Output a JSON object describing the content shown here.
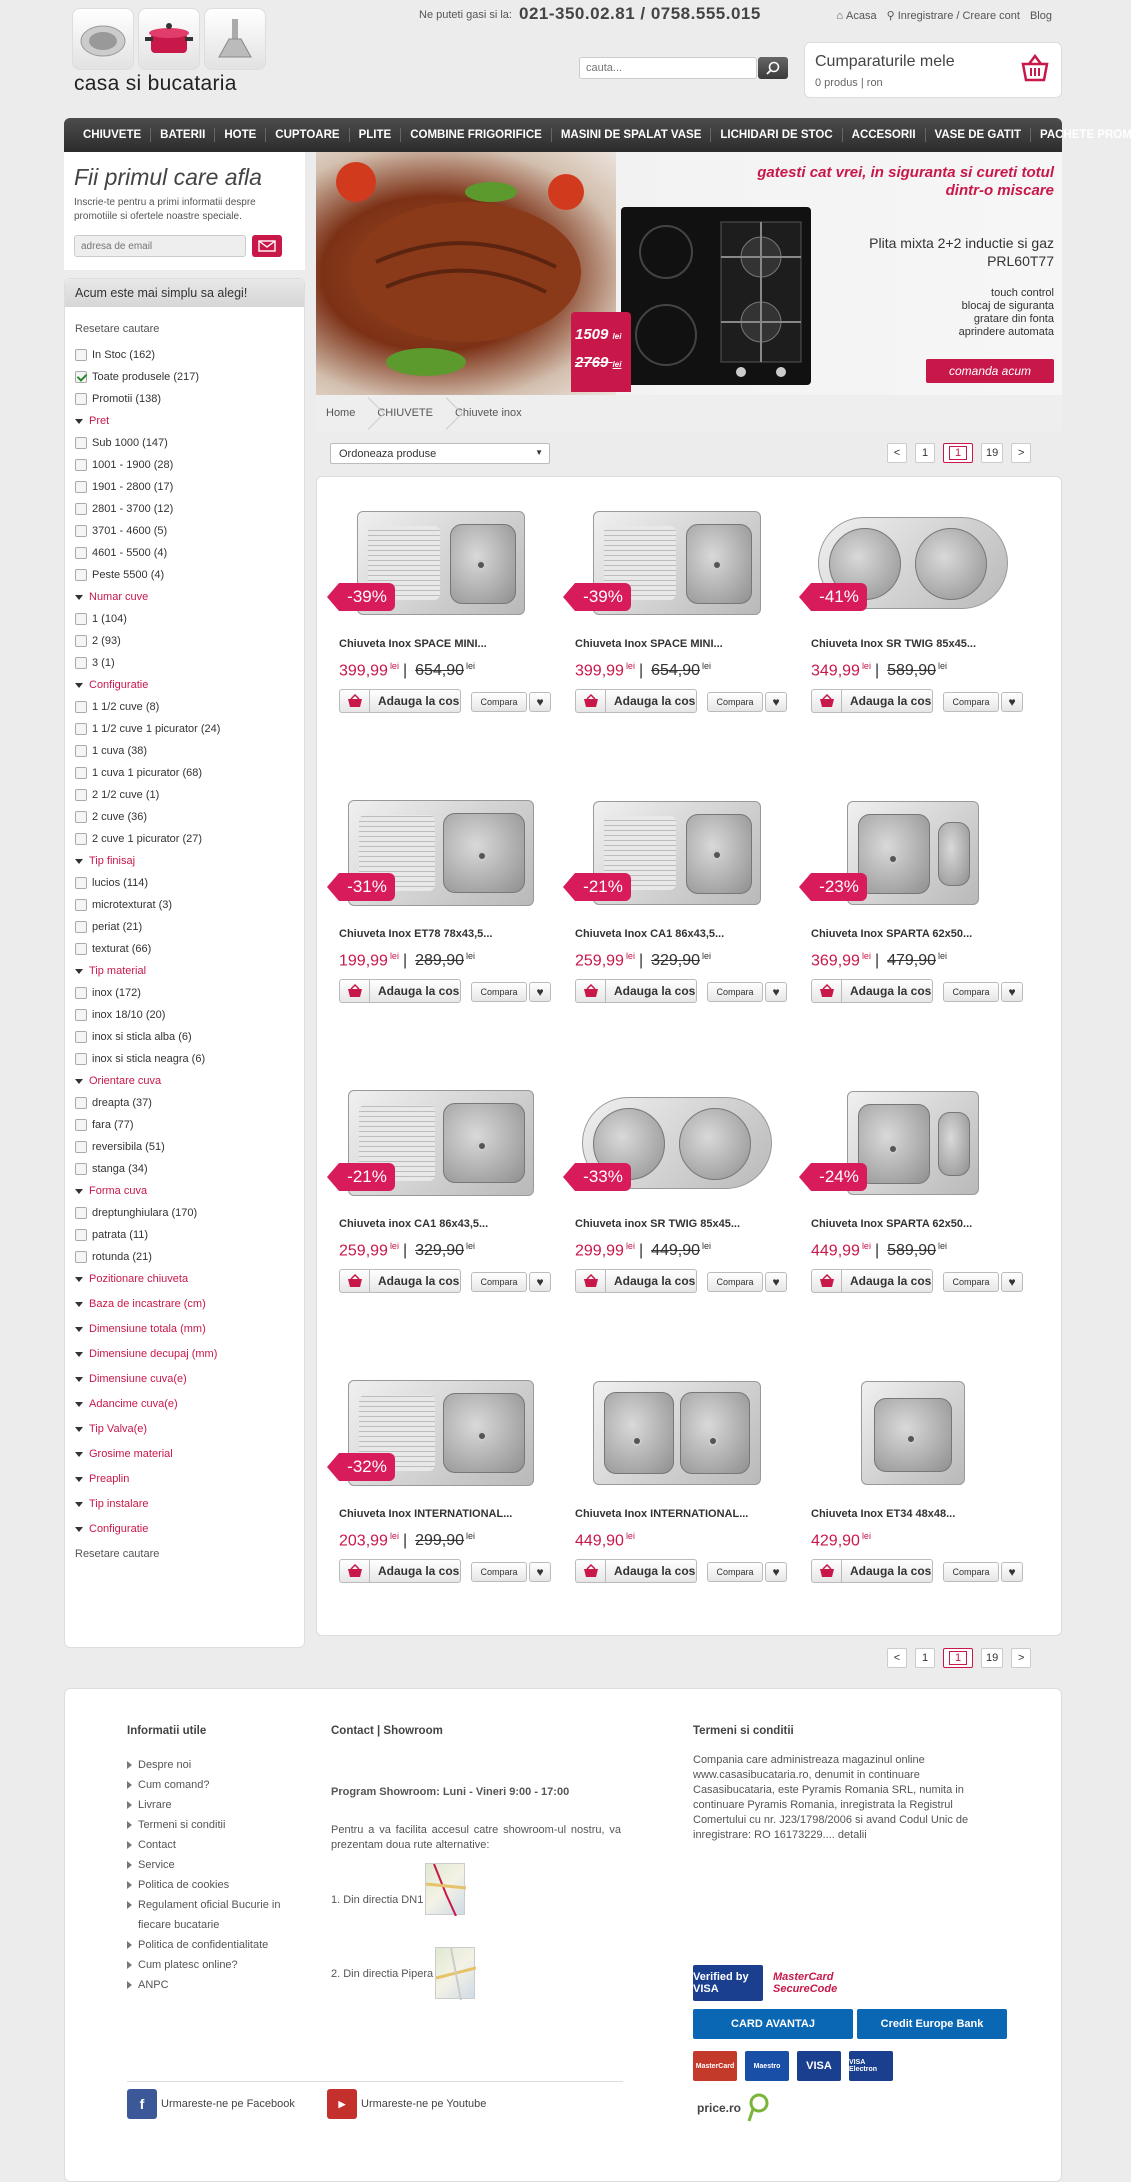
{
  "header": {
    "phone_label": "Ne puteti gasi si la:",
    "phone": "021-350.02.81 / 0758.555.015",
    "links": [
      "Acasa",
      "Inregistrare / Creare cont",
      "Blog"
    ],
    "logo": "casa si bucataria",
    "search_placeholder": "cauta...",
    "cart_title": "Cumparaturile mele",
    "cart_sub": "0 produs | ron"
  },
  "nav": [
    "CHIUVETE",
    "BATERII",
    "HOTE",
    "CUPTOARE",
    "PLITE",
    "COMBINE FRIGORIFICE",
    "MASINI DE SPALAT VASE",
    "LICHIDARI DE STOC",
    "ACCESORII",
    "VASE DE GATIT",
    "PACHETE PROMO"
  ],
  "newsletter": {
    "title": "Fii primul care afla",
    "text": "Inscrie-te pentru a primi informatii despre promotiile si ofertele noastre speciale.",
    "placeholder": "adresa de email"
  },
  "filters": {
    "title": "Acum este mai simplu sa alegi!",
    "reset": "Resetare cautare",
    "top": [
      {
        "label": "In Stoc (162)",
        "checked": false
      },
      {
        "label": "Toate produsele (217)",
        "checked": true
      },
      {
        "label": "Promotii (138)",
        "checked": false
      }
    ],
    "groups": [
      {
        "title": "Pret",
        "items": [
          "Sub 1000 (147)",
          "1001 - 1900 (28)",
          "1901 - 2800 (17)",
          "2801 - 3700 (12)",
          "3701 - 4600 (5)",
          "4601 - 5500 (4)",
          "Peste 5500 (4)"
        ]
      },
      {
        "title": "Numar cuve",
        "items": [
          "1 (104)",
          "2 (93)",
          "3 (1)"
        ]
      },
      {
        "title": "Configuratie",
        "items": [
          "1 1/2 cuve (8)",
          "1 1/2 cuve 1 picurator (24)",
          "1 cuva (38)",
          "1 cuva 1 picurator (68)",
          "2 1/2 cuve (1)",
          "2 cuve (36)",
          "2 cuve 1 picurator (27)"
        ]
      },
      {
        "title": "Tip finisaj",
        "items": [
          "lucios (114)",
          "microtexturat (3)",
          "periat (21)",
          "texturat (66)"
        ]
      },
      {
        "title": "Tip material",
        "items": [
          "inox (172)",
          "inox 18/10 (20)",
          "inox si sticla alba (6)",
          "inox si sticla neagra (6)"
        ]
      },
      {
        "title": "Orientare cuva",
        "items": [
          "dreapta (37)",
          "fara (77)",
          "reversibila (51)",
          "stanga (34)"
        ]
      },
      {
        "title": "Forma cuva",
        "items": [
          "dreptunghiulara (170)",
          "patrata (11)",
          "rotunda (21)"
        ]
      }
    ],
    "collapsed": [
      "Pozitionare chiuveta",
      "Baza de incastrare (cm)",
      "Dimensiune totala (mm)",
      "Dimensiune decupaj (mm)",
      "Dimensiune cuva(e)",
      "Adancime cuva(e)",
      "Tip Valva(e)",
      "Grosime material",
      "Preaplin",
      "Tip instalare",
      "Configuratie"
    ]
  },
  "banner": {
    "headline": "gatesti cat vrei, in siguranta si cureti totul dintr-o miscare",
    "model": "Plita mixta 2+2 inductie si gaz PRL60T77",
    "features": [
      "touch control",
      "blocaj de siguranta",
      "gratare din fonta",
      "aprindere automata"
    ],
    "cta": "comanda acum",
    "price_new": "1509",
    "price_old": "2769",
    "price_unit": "lei"
  },
  "breadcrumb": [
    "Home",
    "CHIUVETE",
    "Chiuvete inox"
  ],
  "toolbar": {
    "sort": "Ordoneaza produse",
    "prev": "<",
    "first": "1",
    "current": "1",
    "last": "19",
    "next": ">"
  },
  "product_labels": {
    "cart": "Adauga la cos",
    "compare": "Compara",
    "currency": "lei"
  },
  "products": [
    {
      "name": "Chiuveta Inox SPACE MINI...",
      "discount": "-39%",
      "price": "399,99",
      "old": "654,90",
      "shape": "1.5"
    },
    {
      "name": "Chiuveta Inox SPACE MINI...",
      "discount": "-39%",
      "price": "399,99",
      "old": "654,90",
      "shape": "1.5"
    },
    {
      "name": "Chiuveta Inox SR TWIG 85x45...",
      "discount": "-41%",
      "price": "349,99",
      "old": "589,90",
      "shape": "round2"
    },
    {
      "name": "Chiuveta Inox ET78 78x43,5...",
      "discount": "-31%",
      "price": "199,99",
      "old": "289,90",
      "shape": "1d"
    },
    {
      "name": "Chiuveta Inox CA1 86x43,5...",
      "discount": "-21%",
      "price": "259,99",
      "old": "329,90",
      "shape": "1.5"
    },
    {
      "name": "Chiuveta Inox SPARTA 62x50...",
      "discount": "-23%",
      "price": "369,99",
      "old": "479,90",
      "shape": "1.5s"
    },
    {
      "name": "Chiuveta inox CA1 86x43,5...",
      "discount": "-21%",
      "price": "259,99",
      "old": "329,90",
      "shape": "1d"
    },
    {
      "name": "Chiuveta inox SR TWIG 85x45...",
      "discount": "-33%",
      "price": "299,99",
      "old": "449,90",
      "shape": "round2"
    },
    {
      "name": "Chiuveta Inox SPARTA 62x50...",
      "discount": "-24%",
      "price": "449,99",
      "old": "589,90",
      "shape": "1.5s"
    },
    {
      "name": "Chiuveta Inox INTERNATIONAL...",
      "discount": "-32%",
      "price": "203,99",
      "old": "299,90",
      "shape": "1d"
    },
    {
      "name": "Chiuveta Inox INTERNATIONAL...",
      "discount": "",
      "price": "449,90",
      "old": "",
      "shape": "2"
    },
    {
      "name": "Chiuveta Inox ET34 48x48...",
      "discount": "",
      "price": "429,90",
      "old": "",
      "shape": "sq"
    }
  ],
  "footer": {
    "info_title": "Informatii utile",
    "info_links": [
      "Despre noi",
      "Cum comand?",
      "Livrare",
      "Termeni si conditii",
      "Contact",
      "Service",
      "Politica de cookies",
      "Regulament oficial Bucurie in fiecare bucatarie",
      "Politica de confidentialitate",
      "Cum platesc online?",
      "ANPC"
    ],
    "contact_title": "Contact | Showroom",
    "program": "Program Showroom: Luni - Vineri 9:00 - 17:00",
    "access_text": "Pentru a va facilita accesul catre showroom-ul nostru, va prezentam doua rute alternative:",
    "route1": "1. Din directia DN1",
    "route2": "2. Din directia Pipera",
    "terms_title": "Termeni si conditii",
    "terms_text": "Compania care administreaza magazinul online www.casasibucataria.ro, denumit in continuare Casasibucataria, este Pyramis Romania SRL, numita in continuare Pyramis Romania, inregistrata la Registrul Comertului cu nr. J23/1798/2006 si avand Codul Unic de inregistrare: RO 16173229.... detalii",
    "facebook": "Urmareste-ne pe Facebook",
    "youtube": "Urmareste-ne pe Youtube",
    "cards": [
      "Verified by VISA",
      "MasterCard SecureCode",
      "CARD AVANTAJ",
      "Credit Europe Bank",
      "MasterCard",
      "Maestro",
      "VISA",
      "VISA Electron"
    ],
    "price_ro": "price.ro"
  },
  "colors": {
    "accent": "#c8184a",
    "nav": "#3a3a3a"
  }
}
